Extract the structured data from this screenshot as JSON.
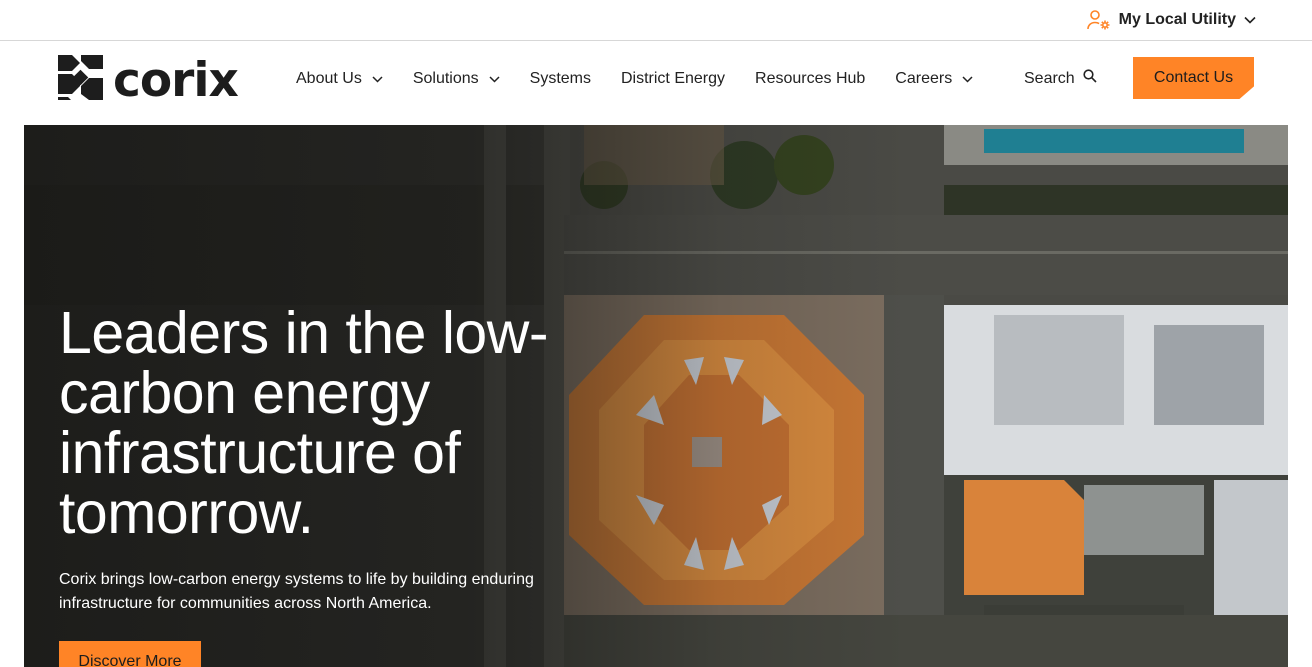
{
  "topbar": {
    "utility_label": "My Local Utility",
    "utility_icon": "user-gear-icon",
    "accent": "#ff8426"
  },
  "nav": {
    "logo_text": "corix",
    "items": [
      {
        "label": "About Us",
        "has_dropdown": true
      },
      {
        "label": "Solutions",
        "has_dropdown": true
      },
      {
        "label": "Systems",
        "has_dropdown": false
      },
      {
        "label": "District Energy",
        "has_dropdown": false
      },
      {
        "label": "Resources Hub",
        "has_dropdown": false
      },
      {
        "label": "Careers",
        "has_dropdown": true
      }
    ],
    "search_label": "Search",
    "contact_label": "Contact Us"
  },
  "hero": {
    "title": "Leaders in the low-carbon energy infrastructure of tomorrow.",
    "subtitle": "Corix brings low-carbon energy systems to life by building enduring infrastructure for communities across North America.",
    "cta_label": "Discover More",
    "image": "aerial-city-photo"
  },
  "colors": {
    "accent": "#ff8426",
    "text": "#1d1d1d",
    "hero_text": "#ffffff"
  }
}
